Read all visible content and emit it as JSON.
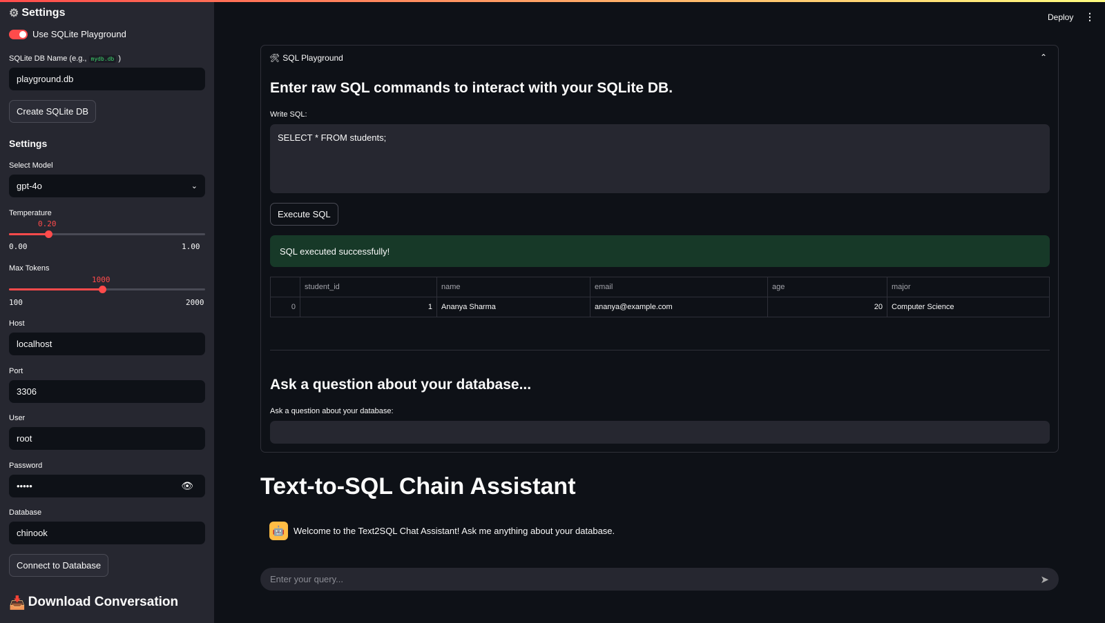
{
  "sidebar": {
    "title": "Settings",
    "toggle_label": "Use SQLite Playground",
    "db_name_label": "SQLite DB Name (e.g., ",
    "db_name_code": "mydb.db",
    "db_name_label_end": " )",
    "db_name_value": "playground.db",
    "create_button": "Create SQLite DB",
    "settings_heading": "Settings",
    "model_label": "Select Model",
    "model_value": "gpt-4o",
    "temperature_label": "Temperature",
    "temperature_value": "0.20",
    "temperature_min": "0.00",
    "temperature_max": "1.00",
    "temperature_fraction": 0.2,
    "max_tokens_label": "Max Tokens",
    "max_tokens_value": "1000",
    "max_tokens_min": "100",
    "max_tokens_max": "2000",
    "host_label": "Host",
    "host_value": "localhost",
    "port_label": "Port",
    "port_value": "3306",
    "user_label": "User",
    "user_value": "root",
    "password_label": "Password",
    "password_value": "•••••",
    "database_label": "Database",
    "database_value": "chinook",
    "connect_button": "Connect to Database",
    "download_heading": "Download Conversation"
  },
  "header": {
    "deploy": "Deploy"
  },
  "playground": {
    "expander_title": "SQL Playground",
    "heading": "Enter raw SQL commands to interact with your SQLite DB.",
    "sql_label": "Write SQL:",
    "sql_value": "SELECT * FROM students;",
    "execute_button": "Execute SQL",
    "success": "SQL executed successfully!",
    "columns": [
      "",
      "student_id",
      "name",
      "email",
      "age",
      "major"
    ],
    "rows": [
      [
        "0",
        "1",
        "Ananya Sharma",
        "ananya@example.com",
        "20",
        "Computer Science"
      ]
    ],
    "question_heading": "Ask a question about your database...",
    "question_label": "Ask a question about your database:",
    "question_value": ""
  },
  "main": {
    "title": "Text-to-SQL Chain Assistant",
    "welcome": "Welcome to the Text2SQL Chat Assistant! Ask me anything about your database.",
    "chat_placeholder": "Enter your query..."
  }
}
